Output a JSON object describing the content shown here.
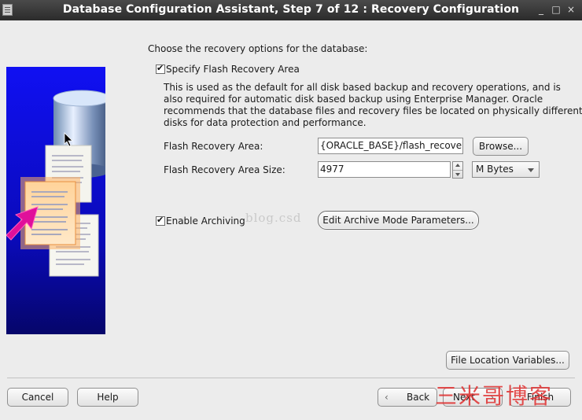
{
  "window": {
    "title": "Database Configuration Assistant, Step 7 of 12 : Recovery Configuration",
    "minimize_glyph": "_",
    "maximize_glyph": "□",
    "close_glyph": "×"
  },
  "main": {
    "intro": "Choose the recovery options for the database:",
    "flash": {
      "checkbox_label": "Specify Flash Recovery Area",
      "checked": true,
      "description": [
        "This is used as the default for all disk based backup and recovery operations, and is",
        "also required for automatic disk based backup using Enterprise Manager. Oracle",
        "recommends that the database files and recovery files be located on physically different",
        "disks for data protection and performance."
      ],
      "area_label": "Flash Recovery Area:",
      "area_value": "{ORACLE_BASE}/flash_recovery_",
      "browse_label": "Browse...",
      "size_label": "Flash Recovery Area Size:",
      "size_value": "4977",
      "unit_value": "M Bytes"
    },
    "archiving": {
      "checkbox_label": "Enable Archiving",
      "checked": true,
      "edit_button_label": "Edit Archive Mode Parameters..."
    },
    "file_location_label": "File Location Variables..."
  },
  "footer": {
    "cancel_label": "Cancel",
    "help_label": "Help",
    "back_label": "Back",
    "next_label": "Next",
    "finish_label": "Finish"
  },
  "watermarks": {
    "url_fragment": "blog.csd",
    "cn_text": "三米哥博客"
  },
  "colors": {
    "illustration_blue": "#0a10e0",
    "arrow_magenta": "#e0109a",
    "titlebar": "#333333"
  },
  "icons": [
    "app-icon",
    "database-cylinder-icon",
    "document-icon",
    "arrow-icon",
    "chevron-left-icon",
    "chevron-right-icon",
    "spinner-up-icon",
    "spinner-down-icon",
    "dropdown-arrow-icon",
    "mouse-cursor-icon"
  ]
}
